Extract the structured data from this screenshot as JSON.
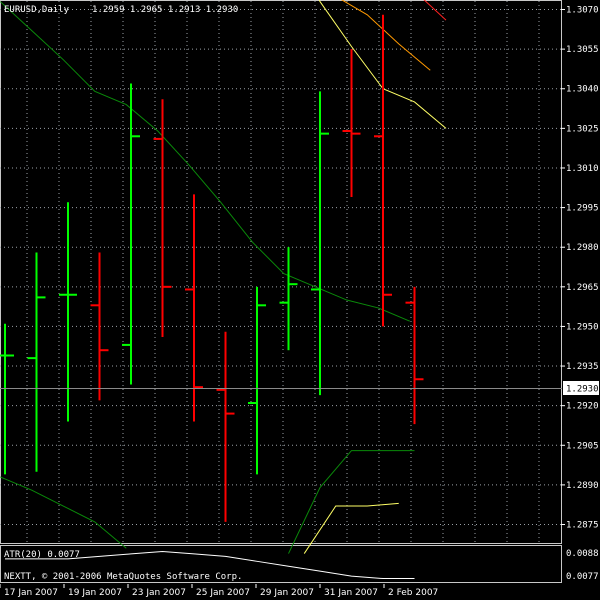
{
  "header": {
    "symbol_timeframe": "EURUSD,Daily",
    "ohlc": "1.2959 1.2965 1.2913 1.2930"
  },
  "price_axis": {
    "labels": [
      "1.3070",
      "1.3055",
      "1.3040",
      "1.3025",
      "1.3010",
      "1.2995",
      "1.2980",
      "1.2965",
      "1.2950",
      "1.2935",
      "1.2920",
      "1.2905",
      "1.2890",
      "1.2875"
    ],
    "current_price": "1.2930"
  },
  "indicator_pane": {
    "title": "ATR(20) 0.0077",
    "copyright": "NEXTT, © 2001-2006 MetaQuotes Software Corp.",
    "axis_labels": [
      "0.0088",
      "0.0077"
    ]
  },
  "time_axis": {
    "labels": [
      "17 Jan 2007",
      "19 Jan 2007",
      "23 Jan 2007",
      "25 Jan 2007",
      "29 Jan 2007",
      "31 Jan 2007",
      "2 Feb 2007"
    ]
  },
  "colors": {
    "background": "#000000",
    "bull": "#00ff00",
    "bear": "#ff0000",
    "grid": "#9aa0a6",
    "ma": "#0a8a0a",
    "band_yellow": "#ffff66",
    "band_orange": "#ff9900",
    "band_red": "#ff2020",
    "atr_line": "#ffffff"
  },
  "chart_data": {
    "type": "ohlc",
    "price_range": [
      1.2868,
      1.3085
    ],
    "bars": [
      {
        "high": 1.2951,
        "open": 1.2939,
        "close": 1.2939,
        "low": 1.2894,
        "dir": "up"
      },
      {
        "high": 1.2978,
        "open": 1.2938,
        "close": 1.2961,
        "low": 1.2895,
        "dir": "up"
      },
      {
        "high": 1.2997,
        "open": 1.2962,
        "close": 1.2962,
        "low": 1.2914,
        "dir": "up"
      },
      {
        "high": 1.2978,
        "open": 1.2958,
        "close": 1.2941,
        "low": 1.2922,
        "dir": "down"
      },
      {
        "high": 1.3042,
        "open": 1.2943,
        "close": 1.3022,
        "low": 1.2928,
        "dir": "up"
      },
      {
        "high": 1.3036,
        "open": 1.3021,
        "close": 1.2965,
        "low": 1.2946,
        "dir": "down"
      },
      {
        "high": 1.3,
        "open": 1.2964,
        "close": 1.2927,
        "low": 1.2914,
        "dir": "down"
      },
      {
        "high": 1.2948,
        "open": 1.2926,
        "close": 1.2917,
        "low": 1.2876,
        "dir": "down"
      },
      {
        "high": 1.2965,
        "open": 1.2921,
        "close": 1.2958,
        "low": 1.2894,
        "dir": "up"
      },
      {
        "high": 1.298,
        "open": 1.2959,
        "close": 1.2966,
        "low": 1.2941,
        "dir": "up"
      },
      {
        "high": 1.3039,
        "open": 1.2964,
        "close": 1.3023,
        "low": 1.2924,
        "dir": "up"
      },
      {
        "high": 1.3055,
        "open": 1.3024,
        "close": 1.3023,
        "low": 1.2999,
        "dir": "down"
      },
      {
        "high": 1.3068,
        "open": 1.3022,
        "close": 1.2962,
        "low": 1.295,
        "dir": "down"
      },
      {
        "high": 1.2965,
        "open": 1.2959,
        "close": 1.293,
        "low": 1.2913,
        "dir": "down"
      }
    ],
    "ma_upper": [
      1.3073,
      1.3062,
      1.3051,
      1.3039,
      1.3034,
      1.3024,
      1.3011,
      1.2997,
      1.2982,
      1.297,
      1.2965,
      1.296,
      1.2957,
      1.2952
    ],
    "ma_lower": [
      1.2893,
      1.2888,
      1.2882,
      1.2876,
      1.2866
    ],
    "band_upper_yellow": [
      1.3099,
      1.3073,
      1.3056,
      1.304,
      1.3035,
      1.3025
    ],
    "band_upper_orange": [
      1.3075,
      1.3068,
      1.3057,
      1.3047
    ],
    "band_upper_red": [
      1.3088,
      1.3084,
      1.3077,
      1.3066
    ],
    "band_lower_green": [
      1.2864,
      1.2889,
      1.2903,
      1.2903,
      1.2903
    ],
    "band_lower_yellow": [
      1.2864,
      1.2882,
      1.2882,
      1.2883
    ],
    "atr_values": [
      0.0085,
      0.0085,
      0.0085,
      0.0086,
      0.0087,
      0.0088,
      0.0087,
      0.0086,
      0.0084,
      0.0082,
      0.008,
      0.0078,
      0.0077,
      0.0077
    ]
  }
}
